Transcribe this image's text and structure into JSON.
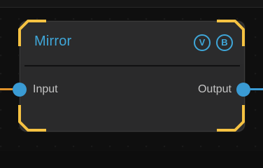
{
  "node": {
    "title": "Mirror",
    "buttons": [
      "V",
      "B"
    ],
    "input_label": "Input",
    "output_label": "Output",
    "selected": true
  },
  "colors": {
    "accent": "#3fa7d9",
    "selection": "#f5c242",
    "input_wire": "#e0922b",
    "port": "#3a9bd4",
    "node_bg": "#2a2a2b"
  }
}
